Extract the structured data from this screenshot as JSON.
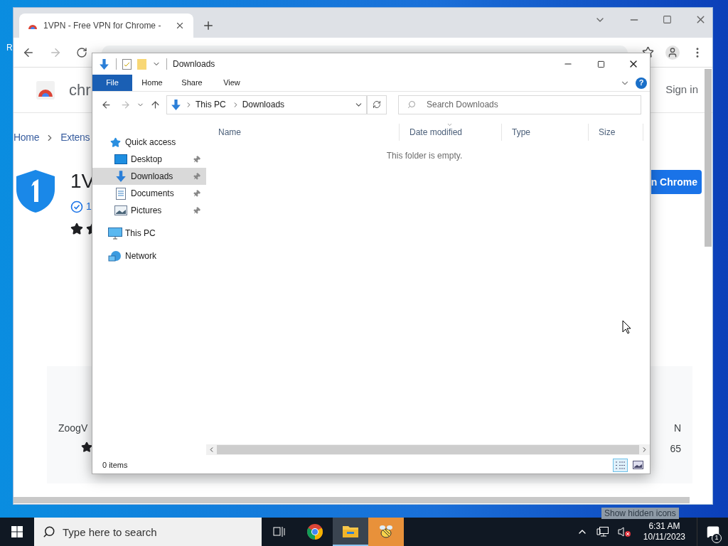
{
  "desktop": {
    "icon_label": "R"
  },
  "browser": {
    "tab": {
      "title": "1VPN - Free VPN for Chrome -",
      "selected": true
    },
    "page": {
      "store_name": "chr",
      "sign_in": "Sign in",
      "breadcrumb": [
        {
          "label": "Home"
        },
        {
          "label": "Extens"
        }
      ],
      "extension": {
        "name": "1V",
        "badge_text": "1",
        "add_button": "n Chrome"
      },
      "related": [
        {
          "name": "ZoogV"
        },
        {
          "name": "N",
          "rating": "65"
        }
      ]
    }
  },
  "explorer": {
    "title": "Downloads",
    "ribbon_tabs": [
      {
        "label": "File",
        "selected": true
      },
      {
        "label": "Home",
        "selected": false
      },
      {
        "label": "Share",
        "selected": false
      },
      {
        "label": "View",
        "selected": false
      }
    ],
    "breadcrumb": [
      "This PC",
      "Downloads"
    ],
    "search": {
      "placeholder": "Search Downloads"
    },
    "help_label": "?",
    "sidebar": [
      {
        "label": "Quick access",
        "kind": "quick",
        "selected": false,
        "children": [
          {
            "label": "Desktop",
            "kind": "desktop",
            "selected": false,
            "pinned": true
          },
          {
            "label": "Downloads",
            "kind": "downloads",
            "selected": true,
            "pinned": true
          },
          {
            "label": "Documents",
            "kind": "documents",
            "selected": false,
            "pinned": true
          },
          {
            "label": "Pictures",
            "kind": "pictures",
            "selected": false,
            "pinned": true
          }
        ]
      },
      {
        "label": "This PC",
        "kind": "pc",
        "selected": false
      },
      {
        "label": "Network",
        "kind": "network",
        "selected": false
      }
    ],
    "columns": [
      {
        "label": "Name",
        "sorted": false
      },
      {
        "label": "Date modified",
        "sorted": true
      },
      {
        "label": "Type",
        "sorted": false
      },
      {
        "label": "Size",
        "sorted": false
      }
    ],
    "empty_message": "This folder is empty.",
    "status": "0 items",
    "views": [
      {
        "kind": "details",
        "selected": true
      },
      {
        "kind": "large",
        "selected": false
      }
    ]
  },
  "taskbar": {
    "search_placeholder": "Type here to search",
    "apps": [
      {
        "kind": "taskview",
        "selected": false
      },
      {
        "kind": "chrome",
        "selected": false
      },
      {
        "kind": "explorer",
        "selected": true
      },
      {
        "kind": "orange",
        "selected": false
      }
    ],
    "tooltip": "Show hidden icons",
    "time": "6:31 AM",
    "date": "10/11/2023",
    "notifications": "1"
  }
}
